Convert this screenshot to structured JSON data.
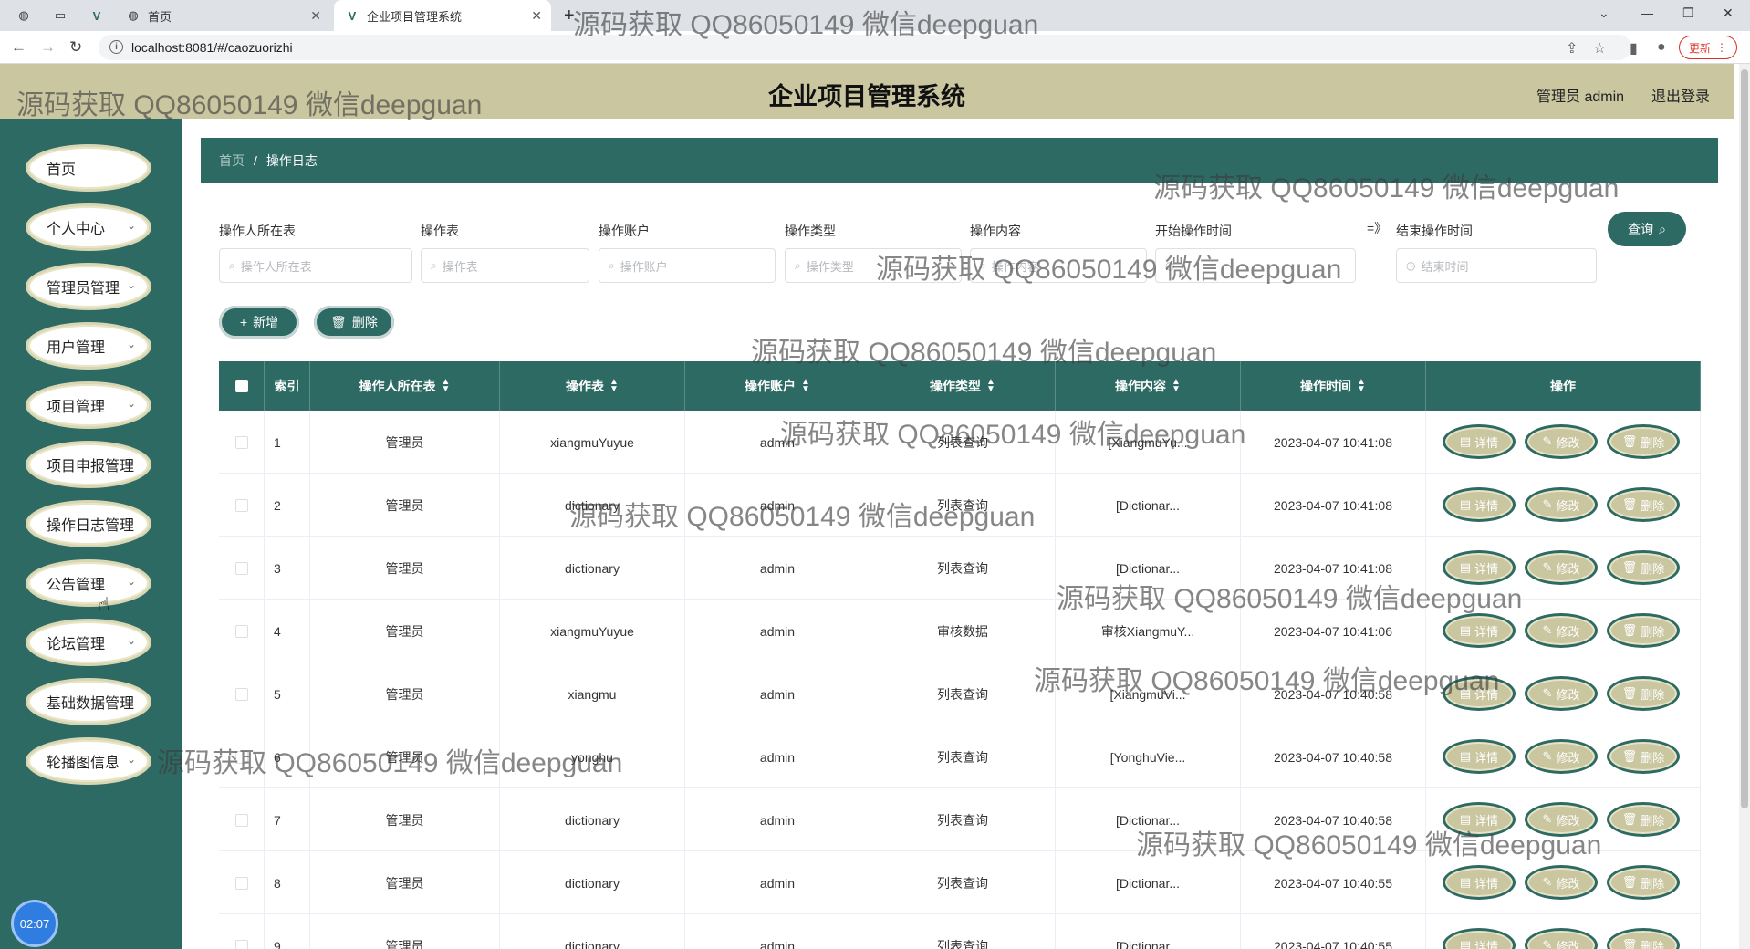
{
  "browser": {
    "tabs": [
      {
        "label": "首页",
        "active": false
      },
      {
        "label": "企业项目管理系统",
        "active": true
      }
    ],
    "url": "localhost:8081/#/caozuorizhi",
    "update_label": "更新"
  },
  "header": {
    "title": "企业项目管理系统",
    "user": "管理员 admin",
    "logout": "退出登录"
  },
  "sidebar": {
    "items": [
      {
        "label": "首页",
        "has_children": false
      },
      {
        "label": "个人中心",
        "has_children": true
      },
      {
        "label": "管理员管理",
        "has_children": true
      },
      {
        "label": "用户管理",
        "has_children": true
      },
      {
        "label": "项目管理",
        "has_children": true
      },
      {
        "label": "项目申报管理",
        "has_children": false
      },
      {
        "label": "操作日志管理",
        "has_children": false
      },
      {
        "label": "公告管理",
        "has_children": true
      },
      {
        "label": "论坛管理",
        "has_children": true
      },
      {
        "label": "基础数据管理",
        "has_children": false
      },
      {
        "label": "轮播图信息",
        "has_children": true
      }
    ],
    "clock": "02:07"
  },
  "breadcrumb": {
    "home": "首页",
    "sep": "/",
    "current": "操作日志"
  },
  "filters": {
    "fields": [
      {
        "label": "操作人所在表",
        "placeholder": "操作人所在表"
      },
      {
        "label": "操作表",
        "placeholder": "操作表"
      },
      {
        "label": "操作账户",
        "placeholder": "操作账户"
      },
      {
        "label": "操作类型",
        "placeholder": "操作类型"
      },
      {
        "label": "操作内容",
        "placeholder": "操作内容"
      },
      {
        "label": "开始操作时间",
        "placeholder": ""
      },
      {
        "label": "结束操作时间",
        "placeholder": "结束时间"
      }
    ],
    "range_sep": "=》",
    "search_label": "查询"
  },
  "actions": {
    "add_label": "新增",
    "delete_label": "删除"
  },
  "table": {
    "headers": [
      "索引",
      "操作人所在表",
      "操作表",
      "操作账户",
      "操作类型",
      "操作内容",
      "操作时间",
      "操作"
    ],
    "row_actions": [
      "详情",
      "修改",
      "删除"
    ],
    "rows": [
      {
        "index": "1",
        "role": "管理员",
        "table": "xiangmuYuyue",
        "account": "admin",
        "type": "列表查询",
        "content": "[XiangmuYu...",
        "time": "2023-04-07 10:41:08"
      },
      {
        "index": "2",
        "role": "管理员",
        "table": "dictionary",
        "account": "admin",
        "type": "列表查询",
        "content": "[Dictionar...",
        "time": "2023-04-07 10:41:08"
      },
      {
        "index": "3",
        "role": "管理员",
        "table": "dictionary",
        "account": "admin",
        "type": "列表查询",
        "content": "[Dictionar...",
        "time": "2023-04-07 10:41:08"
      },
      {
        "index": "4",
        "role": "管理员",
        "table": "xiangmuYuyue",
        "account": "admin",
        "type": "审核数据",
        "content": "审核XiangmuY...",
        "time": "2023-04-07 10:41:06"
      },
      {
        "index": "5",
        "role": "管理员",
        "table": "xiangmu",
        "account": "admin",
        "type": "列表查询",
        "content": "[XiangmuVi...",
        "time": "2023-04-07 10:40:58"
      },
      {
        "index": "6",
        "role": "管理员",
        "table": "yonghu",
        "account": "admin",
        "type": "列表查询",
        "content": "[YonghuVie...",
        "time": "2023-04-07 10:40:58"
      },
      {
        "index": "7",
        "role": "管理员",
        "table": "dictionary",
        "account": "admin",
        "type": "列表查询",
        "content": "[Dictionar...",
        "time": "2023-04-07 10:40:58"
      },
      {
        "index": "8",
        "role": "管理员",
        "table": "dictionary",
        "account": "admin",
        "type": "列表查询",
        "content": "[Dictionar...",
        "time": "2023-04-07 10:40:55"
      },
      {
        "index": "9",
        "role": "管理员",
        "table": "dictionary",
        "account": "admin",
        "type": "列表查询",
        "content": "[Dictionar...",
        "time": "2023-04-07 10:40:55"
      }
    ]
  },
  "watermark": "源码获取 QQ86050149 微信deepguan",
  "colors": {
    "primary": "#2e6a64",
    "header_bg": "#c9c6a0",
    "action_btn": "#c9c6a0"
  }
}
